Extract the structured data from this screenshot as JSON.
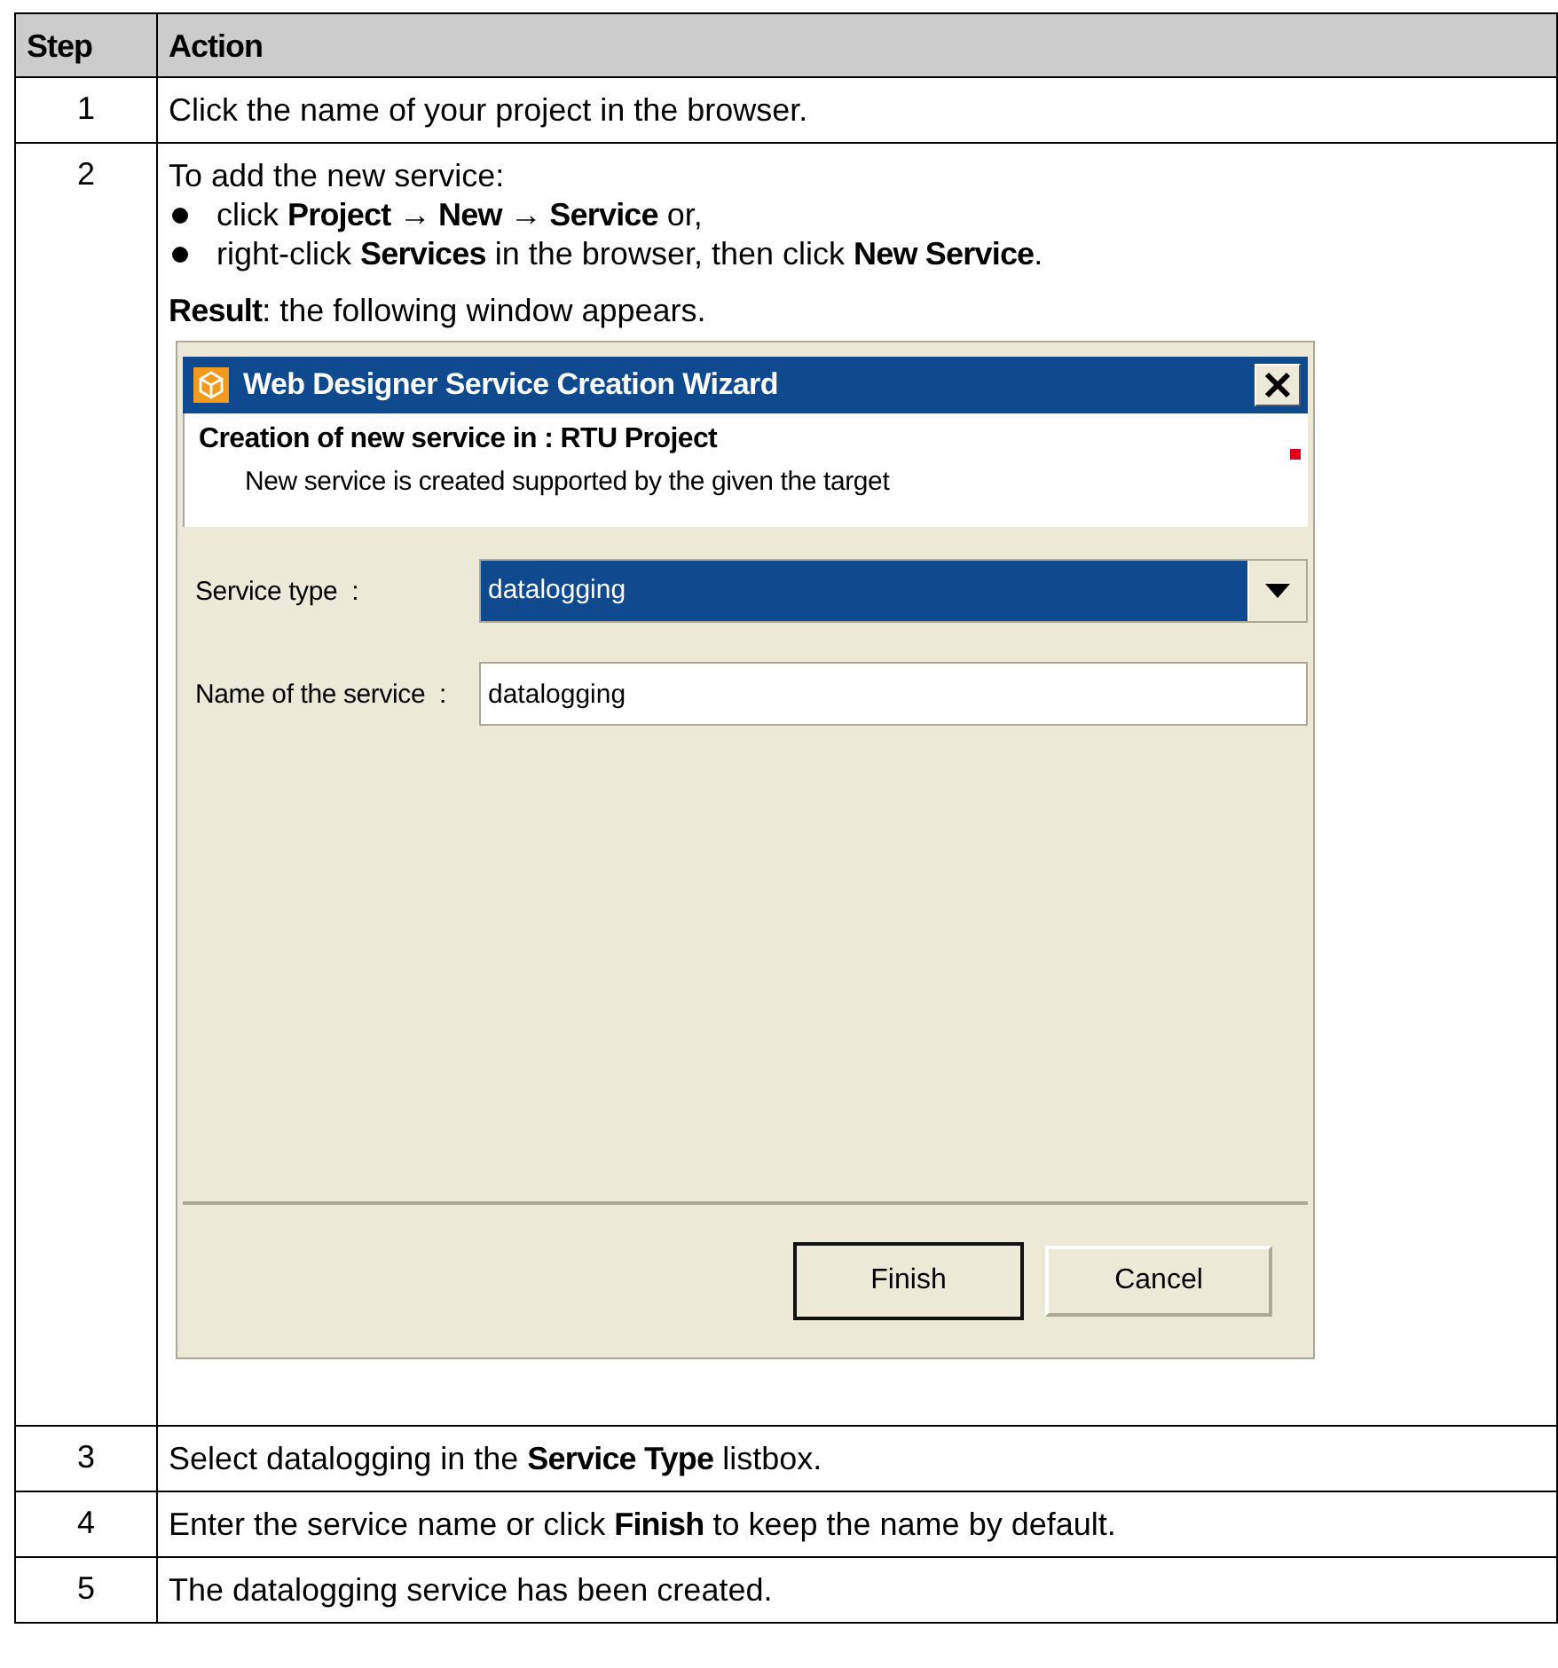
{
  "table": {
    "columns": [
      "Step",
      "Action"
    ],
    "rows": [
      {
        "step": "1",
        "content": [
          {
            "kind": "text",
            "text": "Click the name of your project in the browser."
          }
        ]
      },
      {
        "step": "2",
        "content": [
          {
            "kind": "text",
            "text": "To add the new service:"
          },
          {
            "kind": "bullets",
            "items": [
              "click **Project → New → Service** or,",
              "right-click **Services** in the browser, then click **New Service**."
            ]
          },
          {
            "kind": "text",
            "text": "**Result**: the following window appears."
          },
          {
            "kind": "dialog",
            "title": "Web Designer Service Creation Wizard",
            "header_title": "Creation of new service in : RTU Project",
            "header_subtitle": "New service is created supported by the given the target",
            "fields": [
              {
                "kind": "dropdown",
                "label": "Service type  :",
                "value": "datalogging"
              },
              {
                "kind": "text",
                "label": "Name of the service  :",
                "value": "datalogging"
              }
            ],
            "buttons": [
              {
                "label": "Finish",
                "default": true
              },
              {
                "label": "Cancel",
                "default": false
              }
            ]
          }
        ]
      },
      {
        "step": "3",
        "content": [
          {
            "kind": "text",
            "text": "Select datalogging in the **Service Type** listbox."
          }
        ]
      },
      {
        "step": "4",
        "content": [
          {
            "kind": "text",
            "text": "Enter the service name or click **Finish** to keep the name by default."
          }
        ]
      },
      {
        "step": "5",
        "content": [
          {
            "kind": "text",
            "text": "The datalogging service has been created."
          }
        ]
      }
    ]
  }
}
